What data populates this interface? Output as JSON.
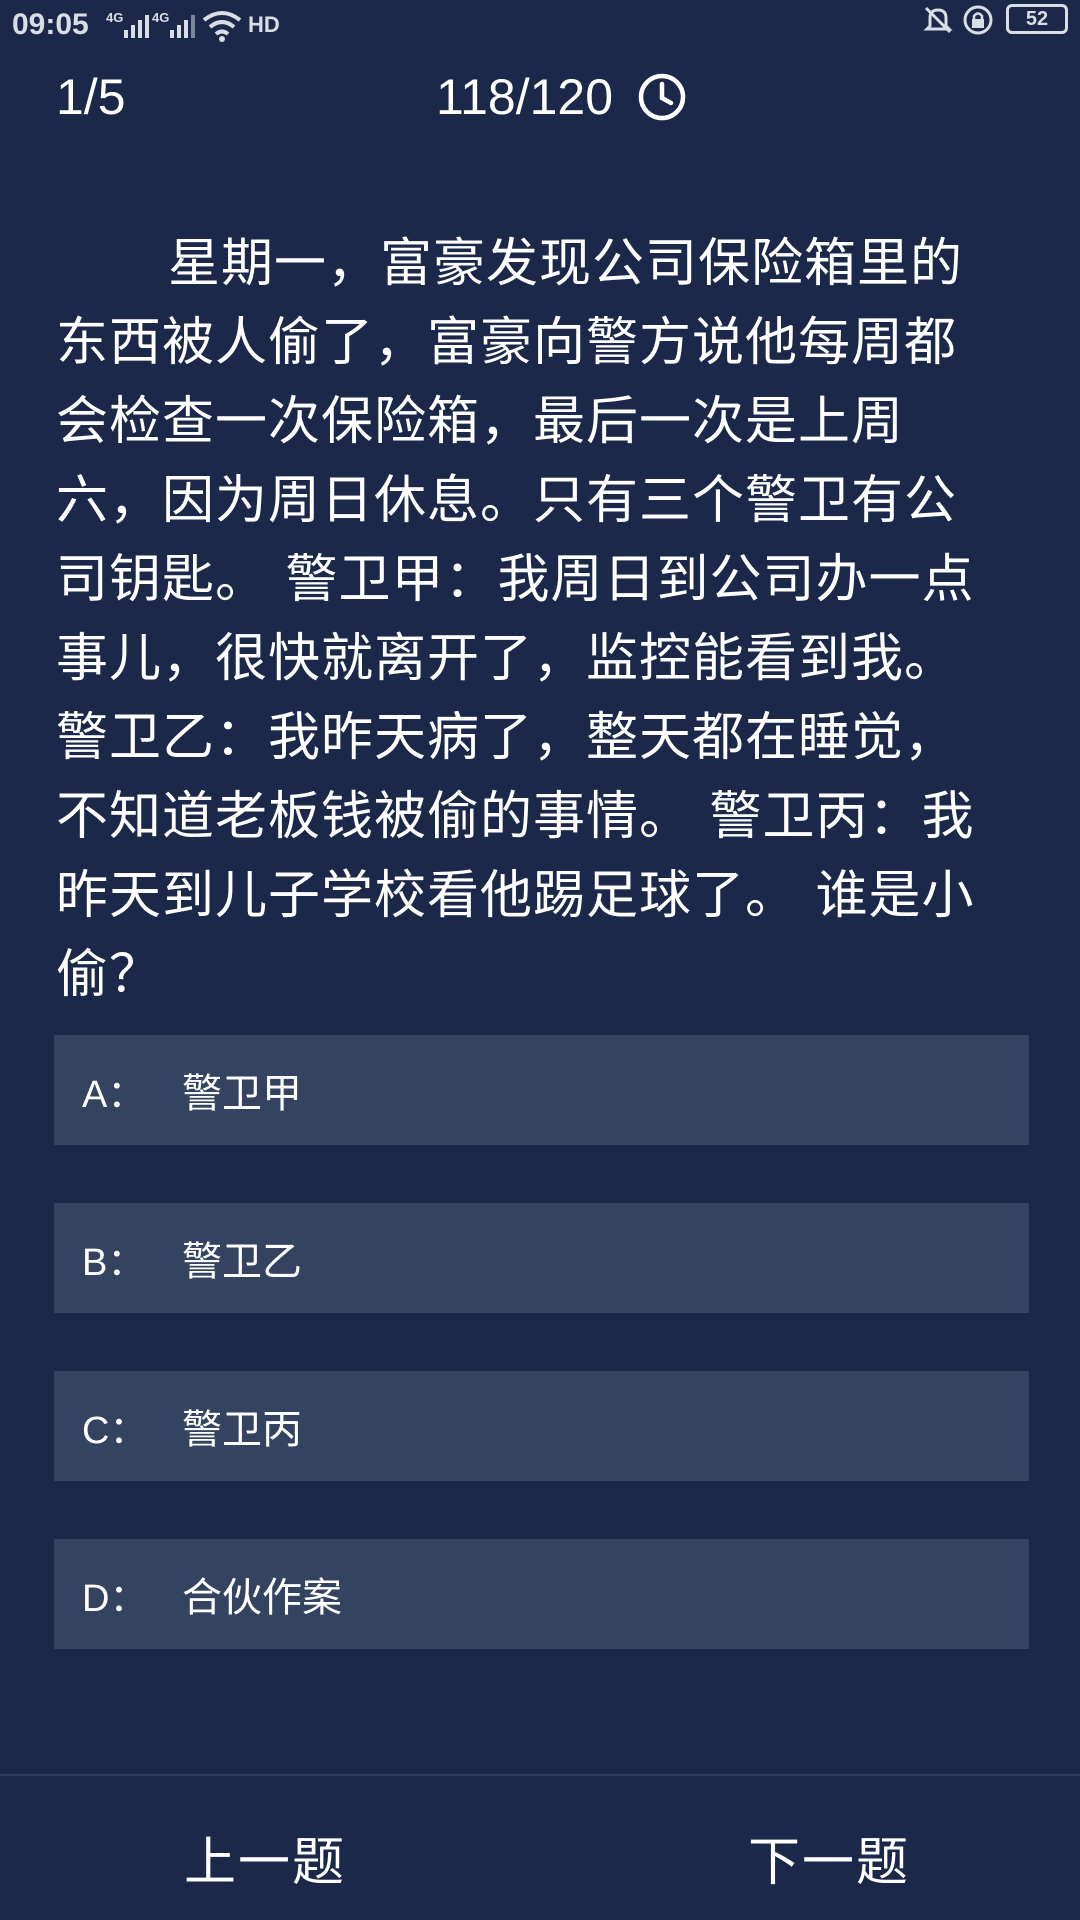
{
  "status_bar": {
    "time": "09:05",
    "network_1": "4G",
    "network_2": "4G",
    "hd_label": "HD",
    "battery": "52",
    "icons": [
      "signal-icon",
      "wifi-icon",
      "bell-muted-icon",
      "rotation-lock-icon",
      "battery-icon"
    ]
  },
  "header": {
    "progress": "1/5",
    "timer": "118/120",
    "timer_icon": "clock-icon"
  },
  "question": {
    "lines": [
      "星期一，富豪发现公司保险箱里的",
      "东西被人偷了，富豪向警方说他每周都",
      "会检查一次保险箱，最后一次是上周",
      "六，因为周日休息。只有三个警卫有公",
      "司钥匙。 警卫甲：我周日到公司办一点",
      "事儿，很快就离开了，监控能看到我。",
      "警卫乙：我昨天病了，整天都在睡觉，",
      "不知道老板钱被偷的事情。 警卫丙：我",
      "昨天到儿子学校看他踢足球了。 谁是小",
      "偷？"
    ]
  },
  "options": [
    {
      "key": "A：",
      "text": "警卫甲"
    },
    {
      "key": "B：",
      "text": "警卫乙"
    },
    {
      "key": "C：",
      "text": "警卫丙"
    },
    {
      "key": "D：",
      "text": "合伙作案"
    }
  ],
  "nav": {
    "prev_label": "上一题",
    "next_label": "下一题"
  },
  "colors": {
    "background": "#1b2849",
    "option_bg": "#334360",
    "text": "#ffffff"
  }
}
